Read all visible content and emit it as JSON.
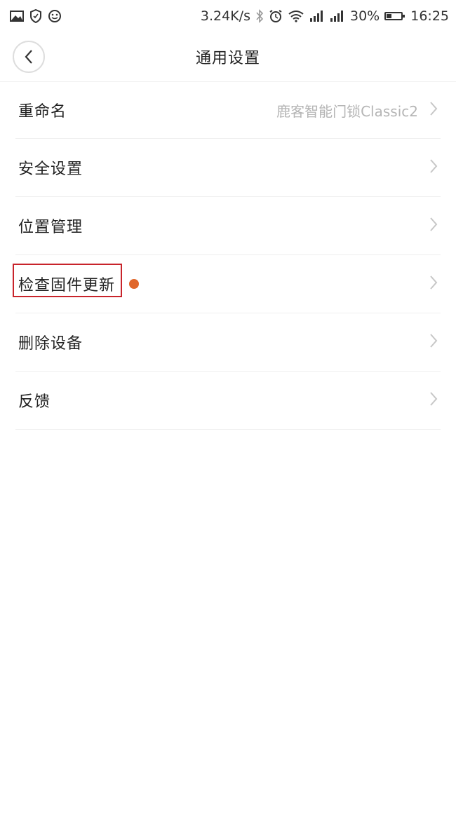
{
  "status_bar": {
    "network_speed": "3.24K/s",
    "battery_percent": "30%",
    "time": "16:25",
    "icons_left": [
      "image-icon",
      "shield-icon",
      "smiley-icon"
    ],
    "icons_right": [
      "bluetooth-icon",
      "alarm-icon",
      "wifi-icon",
      "signal-icon",
      "signal-icon",
      "battery-icon"
    ]
  },
  "header": {
    "title": "通用设置",
    "back_icon": "chevron-left-icon"
  },
  "menu": {
    "items": [
      {
        "label": "重命名",
        "value": "鹿客智能门锁Classic2"
      },
      {
        "label": "安全设置",
        "value": ""
      },
      {
        "label": "位置管理",
        "value": ""
      },
      {
        "label": "检查固件更新",
        "value": "",
        "badge": "update-dot",
        "highlighted": true
      },
      {
        "label": "删除设备",
        "value": ""
      },
      {
        "label": "反馈",
        "value": ""
      }
    ]
  },
  "colors": {
    "highlight_border": "#c8242b",
    "update_dot": "#e0662a",
    "value_text": "#b5b5b5",
    "chevron": "#c7c7c7"
  }
}
